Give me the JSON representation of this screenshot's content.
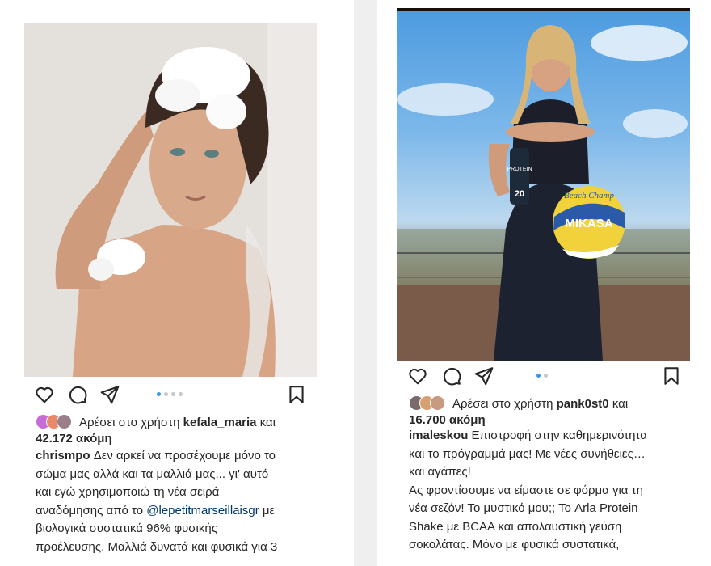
{
  "left_post": {
    "liked_prefix": "Αρέσει στο χρήστη",
    "liked_user": "kefala_maria",
    "liked_and": "και",
    "liked_count": "42.172 ακόμη",
    "username": "chrismpo",
    "caption_lines": [
      "Δεν αρκεί να προσέχουμε μόνο το",
      "σώμα μας αλλά και τα μαλλιά μας... γι' αυτό",
      "και εγώ χρησιμοποιώ τη νέα σειρά",
      "βιολογικά συστατικά 96% φυσικής",
      "προέλευσης. Μαλλιά δυνατά και φυσικά για 3"
    ],
    "caption_line4_prefix": "αναδόμησης από το",
    "caption_mention": "@lepetitmarseillaisgr",
    "caption_line4_suffix": "με",
    "carousel_dots": 4,
    "active_dot": 0
  },
  "right_post": {
    "liked_prefix": "Αρέσει στο χρήστη",
    "liked_user": "pank0st0",
    "liked_and": "και",
    "liked_count": "16.700 ακόμη",
    "username": "imaleskou",
    "caption_lines": [
      "Επιστροφή στην καθημερινότητα",
      "και το πρόγραμμά μας! Με νέες συνήθειες…",
      "και αγάπες!",
      "Ας φροντίσουμε να είμαστε σε φόρμα για τη",
      "νέα σεζόν! Το μυστικό μου;; Το Arla Protein",
      "Shake με BCAA και απολαυστική γεύση",
      "σοκολάτας. Μόνο με φυσικά συστατικά,"
    ],
    "bottle_label": "PROTEIN",
    "bottle_number": "20",
    "ball_script": "Beach Champ",
    "ball_brand": "MIKASA",
    "carousel_dots": 2,
    "active_dot": 0
  },
  "icons": [
    "heart-icon",
    "comment-icon",
    "share-icon",
    "bookmark-icon"
  ],
  "colors": {
    "link": "#00376b",
    "active_dot": "#3897f0",
    "inactive_dot": "#c7c7c7"
  }
}
